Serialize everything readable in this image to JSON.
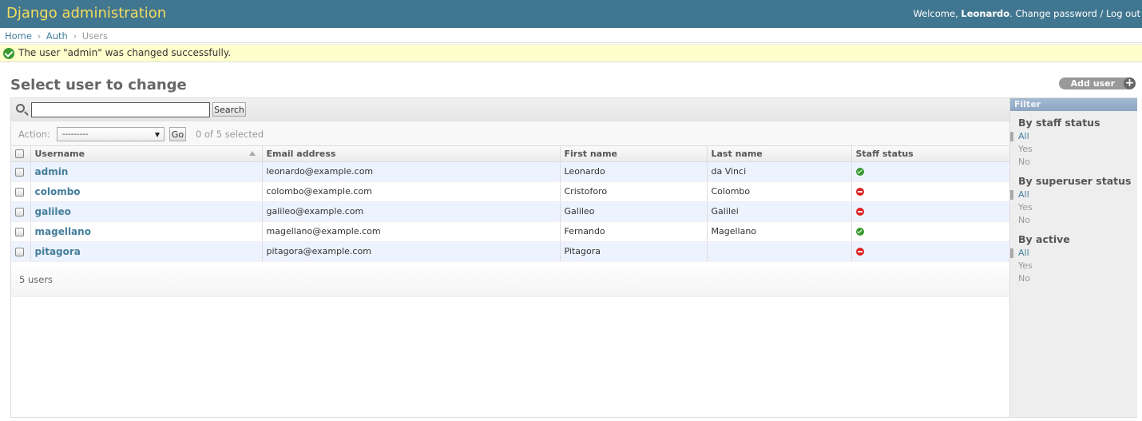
{
  "header": {
    "brand": "Django administration",
    "welcome": "Welcome,",
    "username": "Leonardo",
    "change_password": "Change password",
    "separator": "/",
    "logout": "Log out"
  },
  "breadcrumbs": {
    "home": "Home",
    "auth": "Auth",
    "current": "Users",
    "separator": "›"
  },
  "message": {
    "text": "The user \"admin\" was changed successfully.",
    "icon": "check-circle-icon",
    "color": "#3a9a32"
  },
  "page": {
    "title": "Select user to change",
    "add_label": "Add user"
  },
  "search": {
    "value": "",
    "button": "Search"
  },
  "actions": {
    "label": "Action:",
    "selected_option": "---------",
    "go": "Go",
    "selected_count": "0 of 5 selected"
  },
  "table": {
    "columns": [
      "Username",
      "Email address",
      "First name",
      "Last name",
      "Staff status"
    ],
    "rows": [
      {
        "username": "admin",
        "email": "leonardo@example.com",
        "first": "Leonardo",
        "last": "da Vinci",
        "staff": true
      },
      {
        "username": "colombo",
        "email": "colombo@example.com",
        "first": "Cristoforo",
        "last": "Colombo",
        "staff": false
      },
      {
        "username": "galileo",
        "email": "galileo@example.com",
        "first": "Galileo",
        "last": "Galilei",
        "staff": false
      },
      {
        "username": "magellano",
        "email": "magellano@example.com",
        "first": "Fernando",
        "last": "Magellano",
        "staff": true
      },
      {
        "username": "pitagora",
        "email": "pitagora@example.com",
        "first": "Pitagora",
        "last": "",
        "staff": false
      }
    ]
  },
  "paginator": {
    "text": "5 users"
  },
  "filter": {
    "title": "Filter",
    "groups": [
      {
        "title": "By staff status",
        "options": [
          "All",
          "Yes",
          "No"
        ],
        "selected": "All"
      },
      {
        "title": "By superuser status",
        "options": [
          "All",
          "Yes",
          "No"
        ],
        "selected": "All"
      },
      {
        "title": "By active",
        "options": [
          "All",
          "Yes",
          "No"
        ],
        "selected": "All"
      }
    ]
  },
  "colors": {
    "header_bg": "#417690",
    "brand": "#f5dd5d",
    "link": "#447e9b",
    "message_bg": "#ffffcc",
    "row_alt": "#edf3fe",
    "staff_yes": "#3a9a32",
    "staff_no": "#dd2222"
  }
}
